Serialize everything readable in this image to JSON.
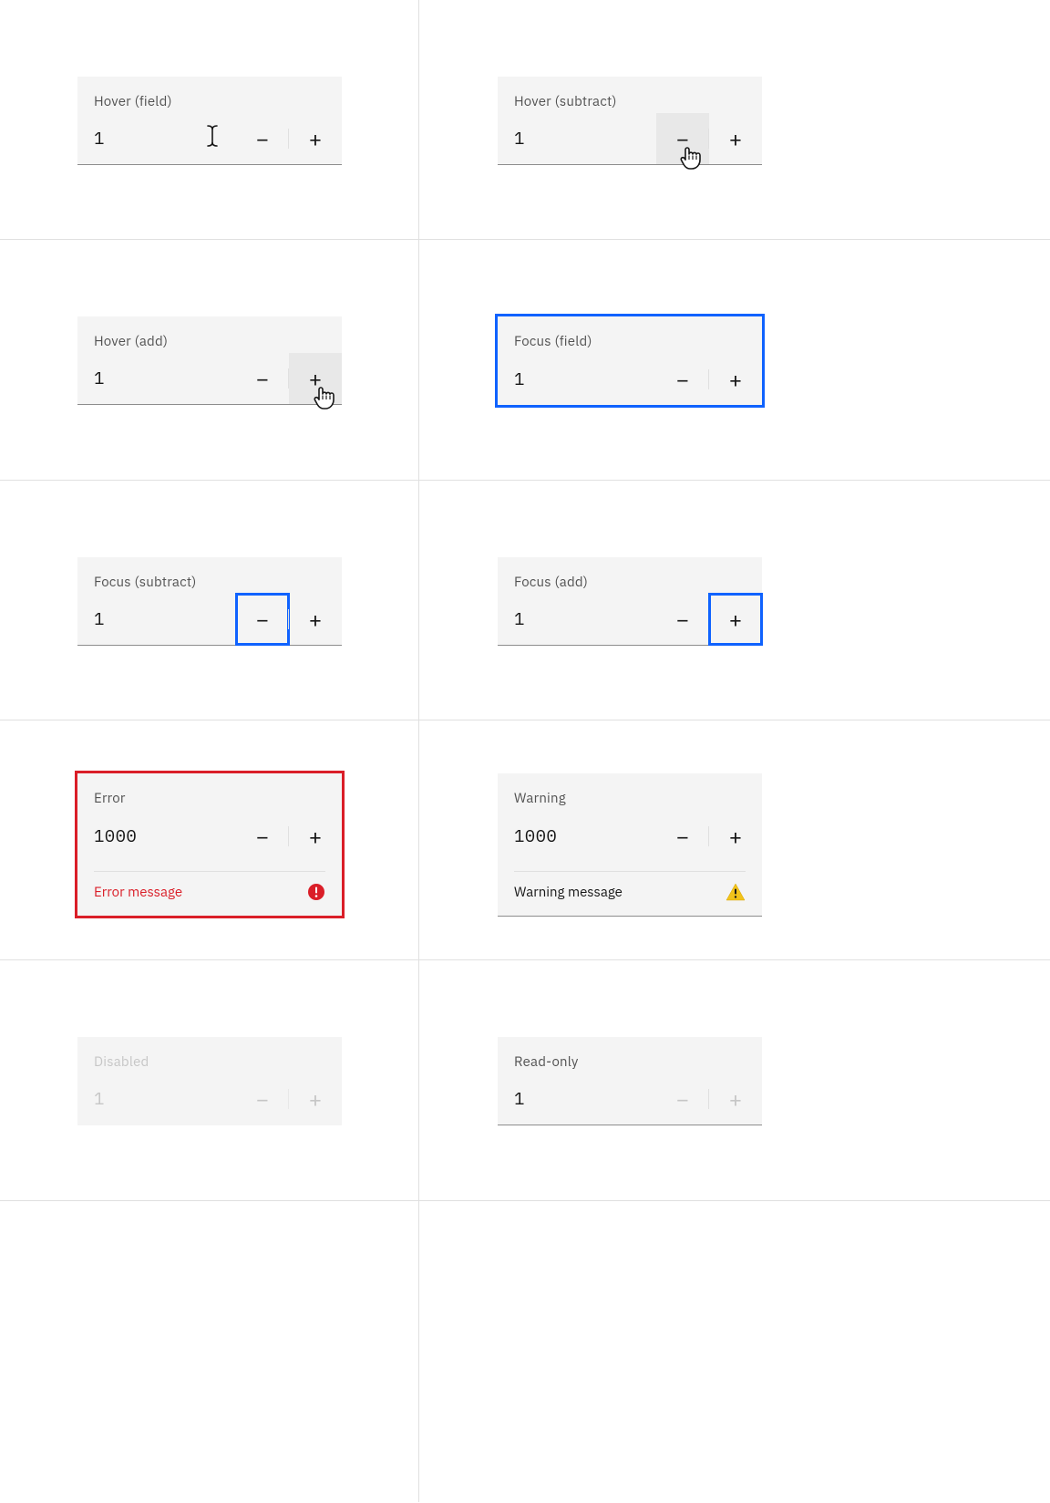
{
  "colors": {
    "field_bg": "#f4f4f4",
    "border": "#8d8d8d",
    "divider": "#e0e0e0",
    "text_primary": "#161616",
    "text_secondary": "#525252",
    "disabled": "#c6c6c6",
    "focus": "#0f62fe",
    "error": "#da1e28",
    "warning": "#f1c21b",
    "hover_bg": "#e8e8e8"
  },
  "hover_field": {
    "label": "Hover (field)",
    "value": "1"
  },
  "hover_subtract": {
    "label": "Hover (subtract)",
    "value": "1"
  },
  "hover_add": {
    "label": "Hover (add)",
    "value": "1"
  },
  "focus_field": {
    "label": "Focus (field)",
    "value": "1"
  },
  "focus_subtract": {
    "label": "Focus (subtract)",
    "value": "1"
  },
  "focus_add": {
    "label": "Focus (add)",
    "value": "1"
  },
  "error_state": {
    "label": "Error",
    "value": "1000",
    "message": "Error message"
  },
  "warning_state": {
    "label": "Warning",
    "value": "1000",
    "message": "Warning message"
  },
  "disabled_state": {
    "label": "Disabled",
    "value": "1"
  },
  "readonly_state": {
    "label": "Read-only",
    "value": "1"
  },
  "glyphs": {
    "minus": "−",
    "plus": "+"
  },
  "icons": {
    "error": "error-filled-icon",
    "warning": "warning-filled-icon",
    "text_cursor": "text-cursor-icon",
    "pointer_cursor": "pointer-cursor-icon"
  }
}
